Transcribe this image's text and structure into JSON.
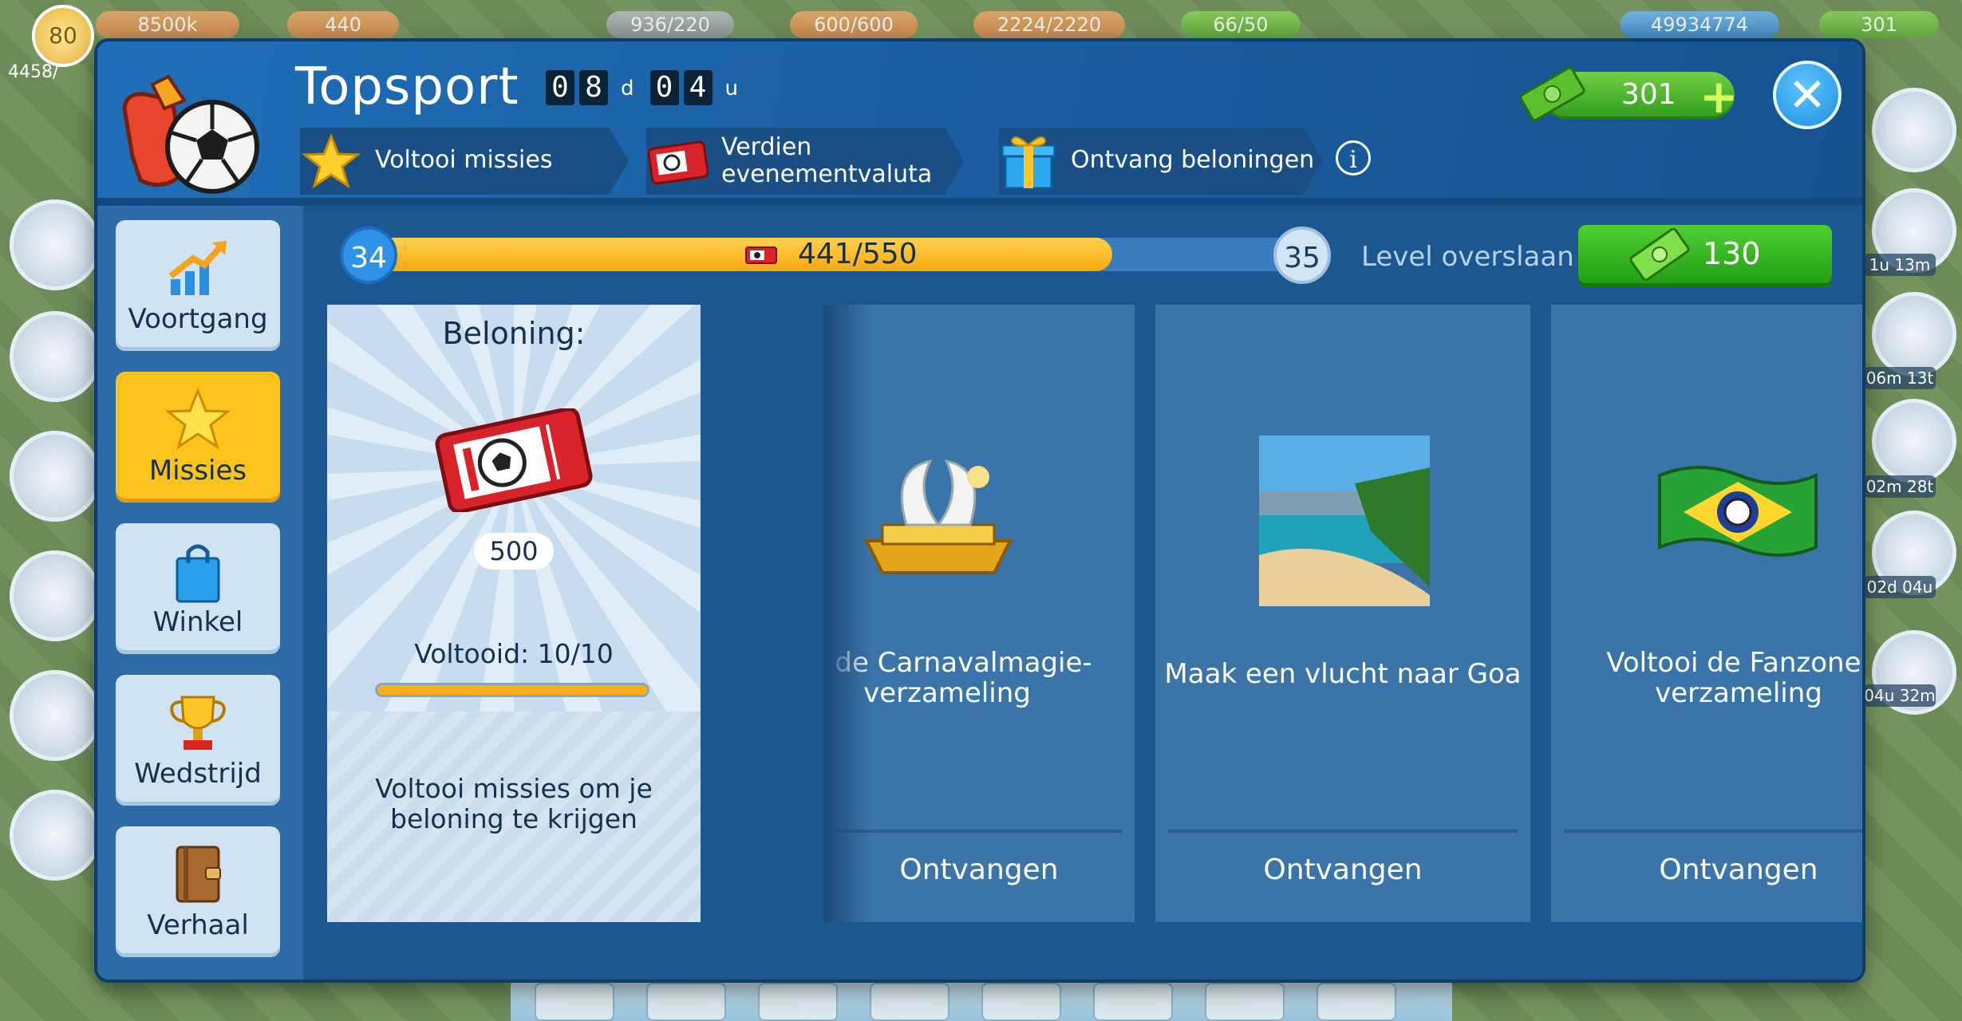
{
  "hud": {
    "level": "80",
    "population": "4458/",
    "items": [
      "8500k",
      "440",
      "936/220",
      "600/600",
      "2224/2220",
      "66/50",
      "49934774",
      "301"
    ]
  },
  "side_timers": [
    "1u 13m",
    "06m 13t",
    "02m 28t",
    "02d 04u",
    "04u 32m"
  ],
  "dialog": {
    "title": "Topsport",
    "countdown": {
      "d1": "0",
      "d2": "8",
      "unit1": "d",
      "d3": "0",
      "d4": "4",
      "unit2": "u"
    },
    "tabs": [
      {
        "label": "Voltooi missies"
      },
      {
        "label": "Verdien evenementvaluta"
      },
      {
        "label": "Ontvang beloningen"
      }
    ],
    "info_label": "i",
    "cash": "301",
    "cash_plus": "+",
    "close_label": "✕"
  },
  "sidebar": {
    "items": [
      {
        "label": "Voortgang",
        "icon": "progress-arrow-icon"
      },
      {
        "label": "Missies",
        "icon": "star-icon",
        "active": true
      },
      {
        "label": "Winkel",
        "icon": "shopping-bag-icon"
      },
      {
        "label": "Wedstrijd",
        "icon": "trophy-icon"
      },
      {
        "label": "Verhaal",
        "icon": "book-icon"
      }
    ]
  },
  "progress": {
    "current_level": "34",
    "next_level": "35",
    "value_text": "441/550",
    "fraction": 0.8,
    "skip_label": "Level overslaan",
    "skip_cost": "130"
  },
  "reward": {
    "title": "Beloning:",
    "quantity": "500",
    "completed": "Voltooid: 10/10",
    "completed_fraction": 1.0,
    "hint": "Voltooi missies om je beloning te krijgen"
  },
  "missions": [
    {
      "text": "oi de Carnavalmagie-verzameling",
      "button": "Ontvangen",
      "image": "carnival-float-image"
    },
    {
      "text": "Maak een vlucht naar Goa",
      "button": "Ontvangen",
      "image": "goa-beach-image"
    },
    {
      "text": "Voltooi de Fanzone-verzameling",
      "button": "Ontvangen",
      "image": "brazil-flag-image"
    }
  ],
  "colors": {
    "accent_green": "#2f9a1c",
    "accent_yellow": "#fcc31d",
    "panel_blue": "#1d5791"
  }
}
